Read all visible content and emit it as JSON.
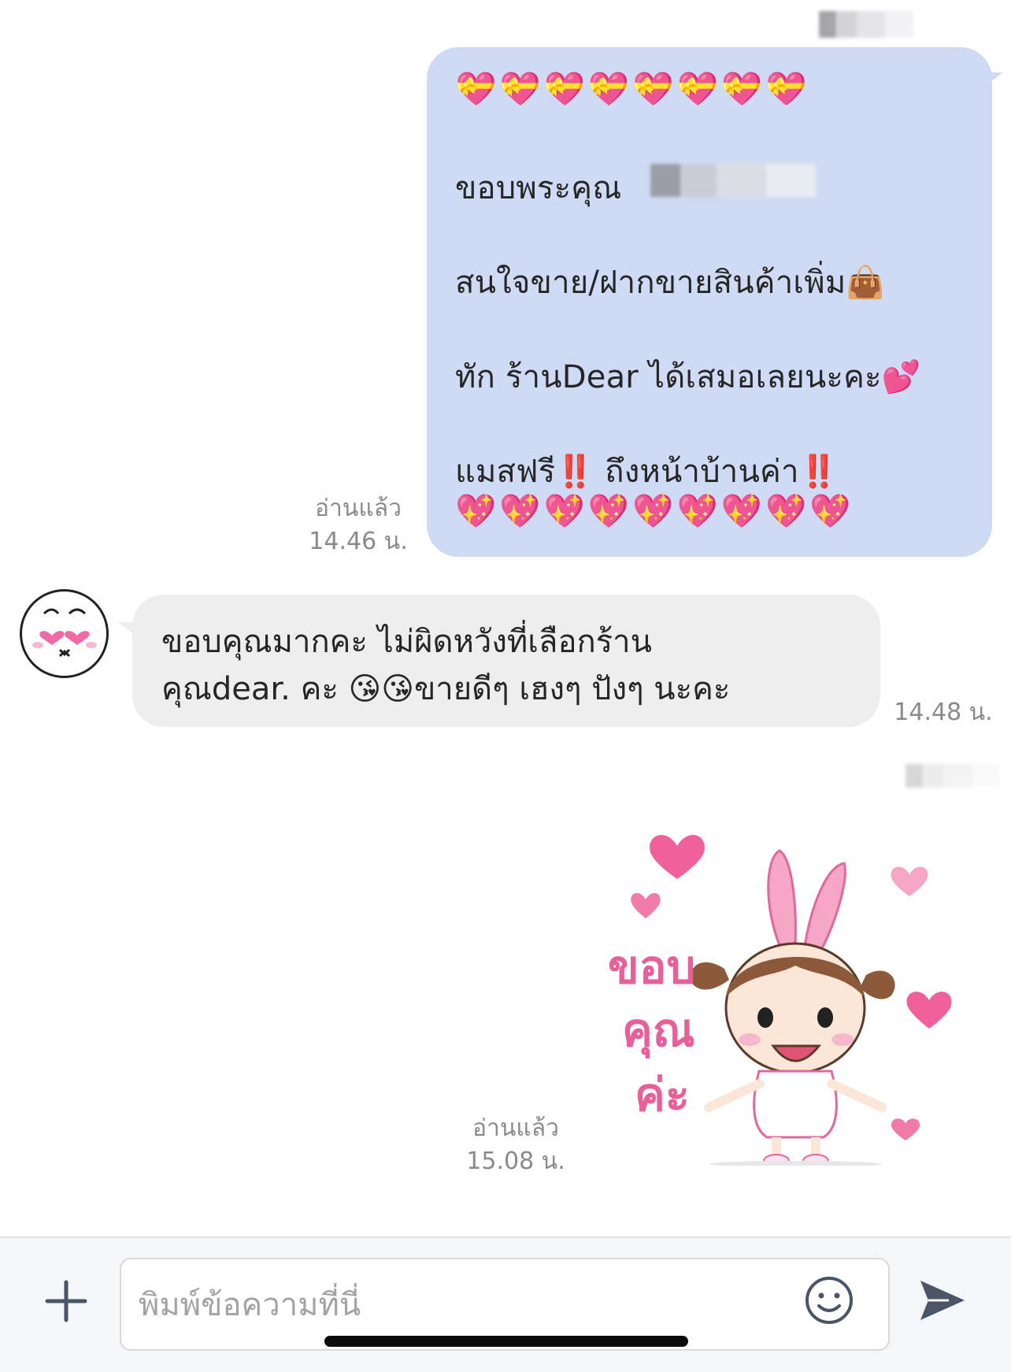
{
  "colors": {
    "outgoing_bubble": "#cfdbf4",
    "incoming_bubble": "#eeeeef",
    "meta_text": "#8a8a8a",
    "sticker_pink": "#f0609a"
  },
  "messages": {
    "outgoing_1": {
      "top_emojis": "💝💝💝💝💝💝💝💝",
      "line_1": "ขอบพระคุณ",
      "line_2": "สนใจขาย/ฝากขายสินค้าเพิ่ม👜",
      "line_3": "ทัก ร้านDear ได้เสมอเลยนะคะ💕",
      "line_4": "แมสฟรี‼️ ถึงหน้าบ้านค่า‼️",
      "bottom_emojis": "💖💖💖💖💖💖💖💖💖",
      "read_label": "อ่านแล้ว",
      "time": "14.46 น."
    },
    "incoming_1": {
      "line_1": "ขอบคุณมากคะ ไม่ผิดหวังที่เลือกร้าน",
      "line_2": "คุณdear. คะ 😘😘ขายดีๆ เฮงๆ ปังๆ นะคะ",
      "time": "14.48 น."
    },
    "outgoing_sticker": {
      "sticker_text": [
        "ขอบ",
        "คุณ",
        "ค่ะ"
      ],
      "read_label": "อ่านแล้ว",
      "time": "15.08 น."
    }
  },
  "input_bar": {
    "placeholder": "พิมพ์ข้อความที่นี่",
    "value": "",
    "plus_icon": "plus-icon",
    "emoji_icon": "smiley-icon",
    "send_icon": "send-icon"
  }
}
